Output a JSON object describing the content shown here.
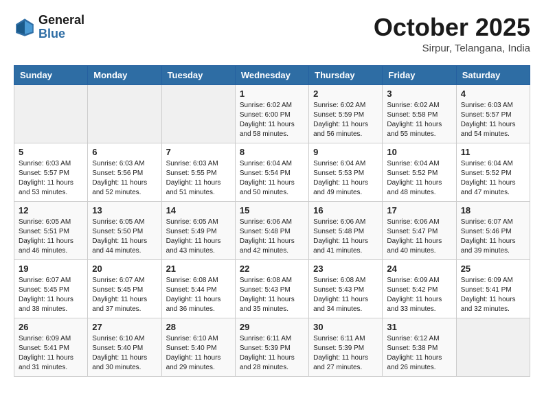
{
  "header": {
    "logo_general": "General",
    "logo_blue": "Blue",
    "month_title": "October 2025",
    "location": "Sirpur, Telangana, India"
  },
  "weekdays": [
    "Sunday",
    "Monday",
    "Tuesday",
    "Wednesday",
    "Thursday",
    "Friday",
    "Saturday"
  ],
  "weeks": [
    [
      {
        "day": "",
        "info": ""
      },
      {
        "day": "",
        "info": ""
      },
      {
        "day": "",
        "info": ""
      },
      {
        "day": "1",
        "info": "Sunrise: 6:02 AM\nSunset: 6:00 PM\nDaylight: 11 hours\nand 58 minutes."
      },
      {
        "day": "2",
        "info": "Sunrise: 6:02 AM\nSunset: 5:59 PM\nDaylight: 11 hours\nand 56 minutes."
      },
      {
        "day": "3",
        "info": "Sunrise: 6:02 AM\nSunset: 5:58 PM\nDaylight: 11 hours\nand 55 minutes."
      },
      {
        "day": "4",
        "info": "Sunrise: 6:03 AM\nSunset: 5:57 PM\nDaylight: 11 hours\nand 54 minutes."
      }
    ],
    [
      {
        "day": "5",
        "info": "Sunrise: 6:03 AM\nSunset: 5:57 PM\nDaylight: 11 hours\nand 53 minutes."
      },
      {
        "day": "6",
        "info": "Sunrise: 6:03 AM\nSunset: 5:56 PM\nDaylight: 11 hours\nand 52 minutes."
      },
      {
        "day": "7",
        "info": "Sunrise: 6:03 AM\nSunset: 5:55 PM\nDaylight: 11 hours\nand 51 minutes."
      },
      {
        "day": "8",
        "info": "Sunrise: 6:04 AM\nSunset: 5:54 PM\nDaylight: 11 hours\nand 50 minutes."
      },
      {
        "day": "9",
        "info": "Sunrise: 6:04 AM\nSunset: 5:53 PM\nDaylight: 11 hours\nand 49 minutes."
      },
      {
        "day": "10",
        "info": "Sunrise: 6:04 AM\nSunset: 5:52 PM\nDaylight: 11 hours\nand 48 minutes."
      },
      {
        "day": "11",
        "info": "Sunrise: 6:04 AM\nSunset: 5:52 PM\nDaylight: 11 hours\nand 47 minutes."
      }
    ],
    [
      {
        "day": "12",
        "info": "Sunrise: 6:05 AM\nSunset: 5:51 PM\nDaylight: 11 hours\nand 46 minutes."
      },
      {
        "day": "13",
        "info": "Sunrise: 6:05 AM\nSunset: 5:50 PM\nDaylight: 11 hours\nand 44 minutes."
      },
      {
        "day": "14",
        "info": "Sunrise: 6:05 AM\nSunset: 5:49 PM\nDaylight: 11 hours\nand 43 minutes."
      },
      {
        "day": "15",
        "info": "Sunrise: 6:06 AM\nSunset: 5:48 PM\nDaylight: 11 hours\nand 42 minutes."
      },
      {
        "day": "16",
        "info": "Sunrise: 6:06 AM\nSunset: 5:48 PM\nDaylight: 11 hours\nand 41 minutes."
      },
      {
        "day": "17",
        "info": "Sunrise: 6:06 AM\nSunset: 5:47 PM\nDaylight: 11 hours\nand 40 minutes."
      },
      {
        "day": "18",
        "info": "Sunrise: 6:07 AM\nSunset: 5:46 PM\nDaylight: 11 hours\nand 39 minutes."
      }
    ],
    [
      {
        "day": "19",
        "info": "Sunrise: 6:07 AM\nSunset: 5:45 PM\nDaylight: 11 hours\nand 38 minutes."
      },
      {
        "day": "20",
        "info": "Sunrise: 6:07 AM\nSunset: 5:45 PM\nDaylight: 11 hours\nand 37 minutes."
      },
      {
        "day": "21",
        "info": "Sunrise: 6:08 AM\nSunset: 5:44 PM\nDaylight: 11 hours\nand 36 minutes."
      },
      {
        "day": "22",
        "info": "Sunrise: 6:08 AM\nSunset: 5:43 PM\nDaylight: 11 hours\nand 35 minutes."
      },
      {
        "day": "23",
        "info": "Sunrise: 6:08 AM\nSunset: 5:43 PM\nDaylight: 11 hours\nand 34 minutes."
      },
      {
        "day": "24",
        "info": "Sunrise: 6:09 AM\nSunset: 5:42 PM\nDaylight: 11 hours\nand 33 minutes."
      },
      {
        "day": "25",
        "info": "Sunrise: 6:09 AM\nSunset: 5:41 PM\nDaylight: 11 hours\nand 32 minutes."
      }
    ],
    [
      {
        "day": "26",
        "info": "Sunrise: 6:09 AM\nSunset: 5:41 PM\nDaylight: 11 hours\nand 31 minutes."
      },
      {
        "day": "27",
        "info": "Sunrise: 6:10 AM\nSunset: 5:40 PM\nDaylight: 11 hours\nand 30 minutes."
      },
      {
        "day": "28",
        "info": "Sunrise: 6:10 AM\nSunset: 5:40 PM\nDaylight: 11 hours\nand 29 minutes."
      },
      {
        "day": "29",
        "info": "Sunrise: 6:11 AM\nSunset: 5:39 PM\nDaylight: 11 hours\nand 28 minutes."
      },
      {
        "day": "30",
        "info": "Sunrise: 6:11 AM\nSunset: 5:39 PM\nDaylight: 11 hours\nand 27 minutes."
      },
      {
        "day": "31",
        "info": "Sunrise: 6:12 AM\nSunset: 5:38 PM\nDaylight: 11 hours\nand 26 minutes."
      },
      {
        "day": "",
        "info": ""
      }
    ]
  ]
}
